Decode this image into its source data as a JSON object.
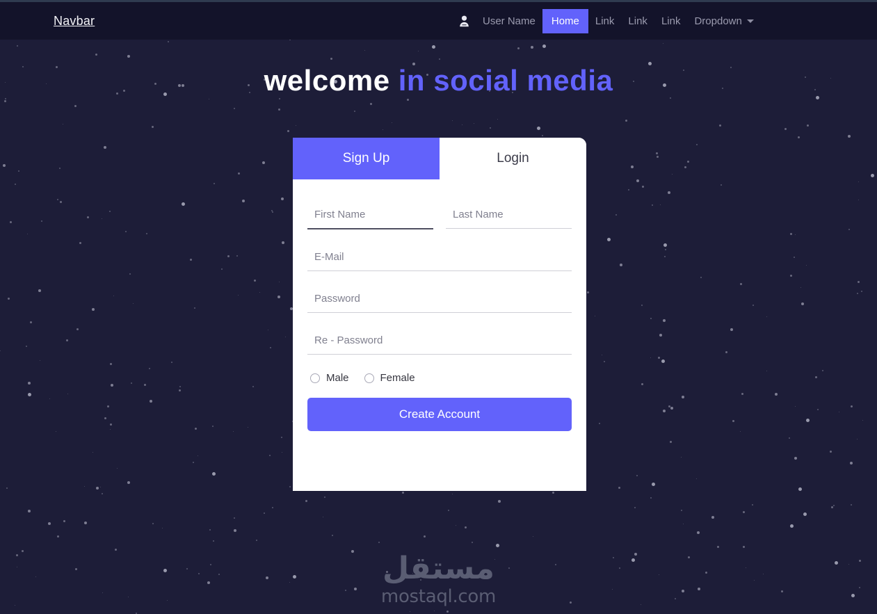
{
  "theme": {
    "page_bg": "#1d1d38",
    "navbar_bg": "#13132a",
    "accent": "#6262fb",
    "card_bg": "#ffffff",
    "star_color": "#b9bacb",
    "muted_text": "#9a9aae",
    "watermark_color": "#5a5d73"
  },
  "navbar": {
    "brand": "Navbar",
    "user_icon": "user-avatar-icon",
    "user_name": "User Name",
    "links": [
      {
        "label": "Home",
        "active": true
      },
      {
        "label": "Link",
        "active": false
      },
      {
        "label": "Link",
        "active": false
      },
      {
        "label": "Link",
        "active": false
      }
    ],
    "dropdown": {
      "label": "Dropdown",
      "icon": "chevron-down-icon"
    }
  },
  "hero": {
    "part1": "welcome",
    "part2": "in social media"
  },
  "card": {
    "tabs": [
      {
        "label": "Sign Up",
        "active": true
      },
      {
        "label": "Login",
        "active": false
      }
    ],
    "fields": {
      "first_name": {
        "placeholder": "First Name",
        "value": "",
        "focused": true
      },
      "last_name": {
        "placeholder": "Last Name",
        "value": "",
        "focused": false
      },
      "email": {
        "placeholder": "E-Mail",
        "value": "",
        "focused": false
      },
      "password": {
        "placeholder": "Password",
        "value": "",
        "focused": false
      },
      "re_password": {
        "placeholder": "Re - Password",
        "value": "",
        "focused": false
      }
    },
    "gender": {
      "options": [
        {
          "label": "Male",
          "selected": false
        },
        {
          "label": "Female",
          "selected": false
        }
      ]
    },
    "submit_label": "Create Account"
  },
  "watermark": {
    "arabic": "مستقل",
    "latin": "mostaql.com"
  }
}
